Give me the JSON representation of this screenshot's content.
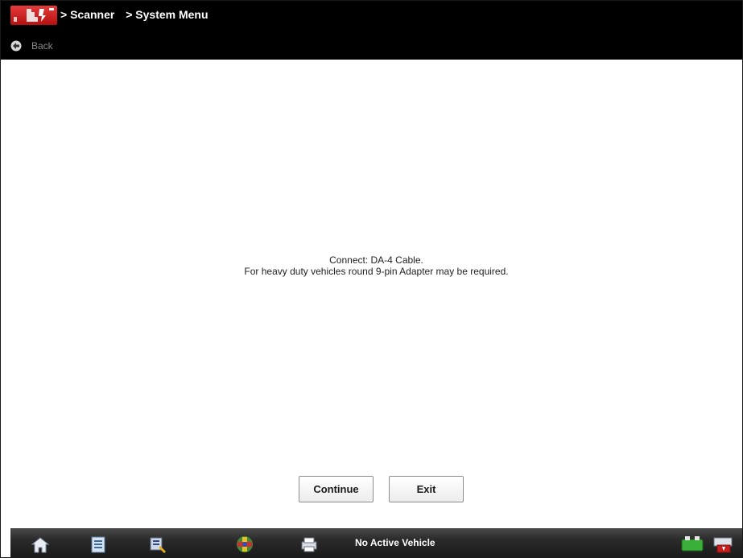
{
  "header": {
    "breadcrumbs": [
      "> Scanner",
      "> System Menu"
    ],
    "back_label": "Back"
  },
  "main": {
    "message_line1": "Connect: DA-4 Cable.",
    "message_line2": "For heavy duty vehicles round 9-pin Adapter may be required."
  },
  "buttons": {
    "continue_label": "Continue",
    "exit_label": "Exit"
  },
  "taskbar": {
    "status_text": "No Active Vehicle",
    "icons": [
      "home-icon",
      "data-list-icon",
      "tools-icon",
      "vehicle-icon",
      "print-icon",
      "connection-icon",
      "power-icon"
    ]
  },
  "colors": {
    "header_bg": "#000000",
    "logo_red": "#c41a1a",
    "taskbar_bg": "#2a2a2a"
  }
}
